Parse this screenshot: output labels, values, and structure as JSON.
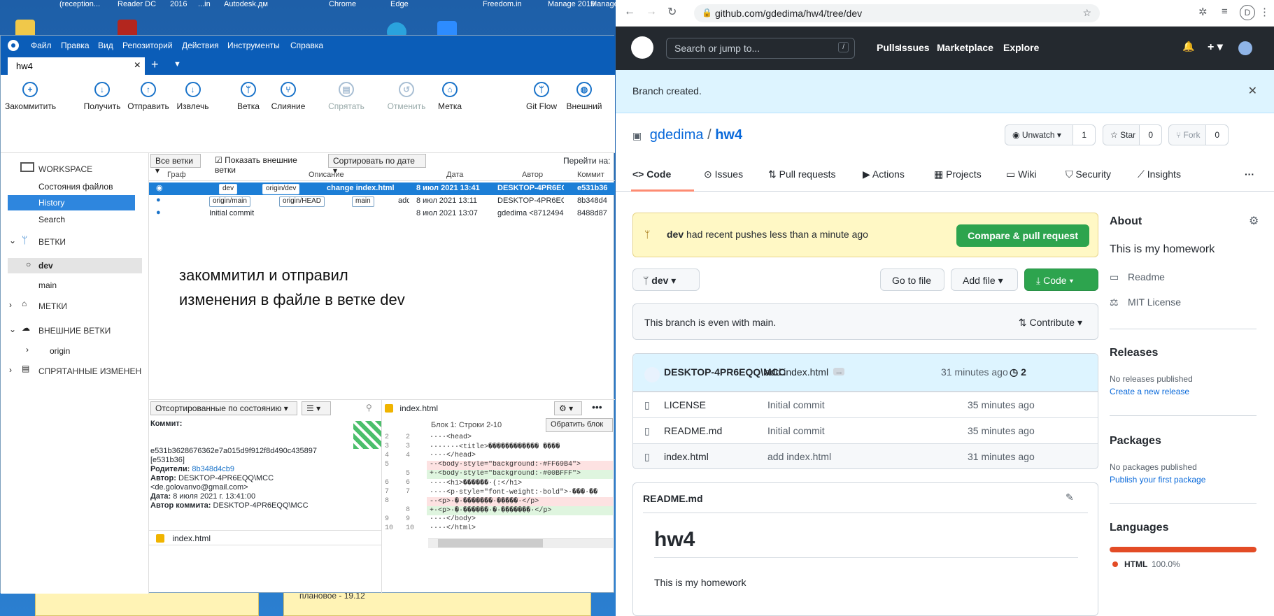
{
  "desktop": {
    "top_labels": [
      "(reception...",
      "Reader DC",
      "2016",
      "...in",
      "Autodesk.дм",
      "Chrome",
      "Edge",
      "Freedom.in",
      "Manage 2019",
      "Manage"
    ],
    "note_mid_text": "плановое - 19.12"
  },
  "sourcetree": {
    "menu": [
      "Файл",
      "Правка",
      "Вид",
      "Репозиторий",
      "Действия",
      "Инструменты",
      "Справка"
    ],
    "tab_label": "hw4",
    "toolbar": [
      {
        "label": "Закоммитить",
        "icon": "commit-icon",
        "glyph": "+",
        "disabled": false
      },
      {
        "label": "Получить",
        "icon": "pull-icon",
        "glyph": "↓",
        "disabled": false
      },
      {
        "label": "Отправить",
        "icon": "push-icon",
        "glyph": "↑",
        "disabled": false
      },
      {
        "label": "Извлечь",
        "icon": "fetch-icon",
        "glyph": "↓",
        "disabled": false
      },
      {
        "label": "Ветка",
        "icon": "branch-icon",
        "glyph": "ᛘ",
        "disabled": false
      },
      {
        "label": "Слияние",
        "icon": "merge-icon",
        "glyph": "⑂",
        "disabled": false
      },
      {
        "label": "Спрятать",
        "icon": "stash-icon",
        "glyph": "▤",
        "disabled": true
      },
      {
        "label": "Отменить",
        "icon": "discard-icon",
        "glyph": "↺",
        "disabled": true
      },
      {
        "label": "Метка",
        "icon": "tag-icon",
        "glyph": "⌂",
        "disabled": false
      },
      {
        "label": "Git Flow",
        "icon": "gitflow-icon",
        "glyph": "ᛘ",
        "disabled": false
      },
      {
        "label": "Внешний",
        "icon": "terminal-icon",
        "glyph": "◍",
        "disabled": false
      }
    ],
    "sidebar": {
      "workspace": "WORKSPACE",
      "file_status": "Состояния файлов",
      "history": "History",
      "search": "Search",
      "branches": "ВЕТКИ",
      "branch_dev": "dev",
      "branch_main": "main",
      "tags": "МЕТКИ",
      "remotes": "ВНЕШНИЕ ВЕТКИ",
      "remote_origin": "origin",
      "stashes": "СПРЯТАННЫЕ ИЗМЕНЕН"
    },
    "filters": {
      "all_branches": "Все ветки",
      "show_remote": "Показать внешние ветки",
      "sort": "Сортировать по дате",
      "goto": "Перейти на:"
    },
    "columns": [
      "Граф",
      "Описание",
      "Дата",
      "Автор",
      "Коммит"
    ],
    "commits": [
      {
        "tags": [
          "dev",
          "origin/dev"
        ],
        "message": "change index.html",
        "date": "8 июл 2021 13:41",
        "author": "DESKTOP-4PR6EC",
        "hash": "e531b36"
      },
      {
        "tags": [
          "origin/main",
          "origin/HEAD",
          "main"
        ],
        "message": "adc",
        "date": "8 июл 2021 13:11",
        "author": "DESKTOP-4PR6EQ",
        "hash": "8b348d4"
      },
      {
        "tags": [],
        "message": "Initial commit",
        "date": "8 июл 2021 13:07",
        "author": "gdedima <8712494",
        "hash": "8488d87"
      }
    ],
    "annotation": [
      "закоммитил и отправил",
      "изменения в файле в ветке dev"
    ],
    "details": {
      "sort_label": "Отсортированные по состоянию",
      "commit_label": "Коммит:",
      "hash": "e531b3628676362e7a015d9f912f8d490c435897",
      "short": "[e531b36]",
      "parents_label": "Родители:",
      "parents": "8b348d4cb9",
      "author_label": "Автор:",
      "author": "DESKTOP-4PR6EQQ\\MCC",
      "email": "<de.golovanvo@gmail.com>",
      "date_label": "Дата:",
      "date": "8 июля 2021 г. 13:41:00",
      "committer_label": "Автор коммита:",
      "committer": "DESKTOP-4PR6EQQ\\MCC",
      "file": "index.html"
    },
    "diff": {
      "file": "index.html",
      "hunk": "Блок 1: Строки 2-10",
      "revert": "Обратить блок",
      "lines": [
        {
          "a": "2",
          "b": "2",
          "t": "ctx",
          "text": "····<head>"
        },
        {
          "a": "3",
          "b": "3",
          "t": "ctx",
          "text": "·······<title>������������ ����"
        },
        {
          "a": "4",
          "b": "4",
          "t": "ctx",
          "text": "····</head>"
        },
        {
          "a": "5",
          "b": "",
          "t": "del",
          "text": "-·<body·style=\"background:·#FF69B4\">"
        },
        {
          "a": "",
          "b": "5",
          "t": "add",
          "text": "+·<body·style=\"background:·#00BFFF\">"
        },
        {
          "a": "6",
          "b": "6",
          "t": "ctx",
          "text": "····<h1>������·(:</h1>"
        },
        {
          "a": "7",
          "b": "7",
          "t": "ctx",
          "text": "····<p·style=\"font-weight:·bold\">·���·��"
        },
        {
          "a": "8",
          "b": "",
          "t": "del",
          "text": "-·<p>·�·�������·�����·</p>"
        },
        {
          "a": "",
          "b": "8",
          "t": "add",
          "text": "+·<p>·�·������·�·�������·</p>"
        },
        {
          "a": "9",
          "b": "9",
          "t": "ctx",
          "text": "····</body>"
        },
        {
          "a": "10",
          "b": "10",
          "t": "ctx",
          "text": "····</html>"
        }
      ]
    }
  },
  "browser": {
    "url": "github.com/gdedima/hw4/tree/dev",
    "profile_initial": "D"
  },
  "github": {
    "search_placeholder": "Search or jump to...",
    "search_key": "/",
    "nav": [
      "Pulls",
      "Issues",
      "Marketplace",
      "Explore"
    ],
    "flash": "Branch created.",
    "owner": "gdedima",
    "sep": "/",
    "repo": "hw4",
    "unwatch": "Unwatch ▾",
    "unwatch_count": "1",
    "star": "Star",
    "star_count": "0",
    "fork": "Fork",
    "fork_count": "0",
    "tabs": [
      "Code",
      "Issues",
      "Pull requests",
      "Actions",
      "Projects",
      "Wiki",
      "Security",
      "Insights"
    ],
    "more": "···",
    "push_branch": "dev",
    "push_text": "had recent pushes less than a minute ago",
    "compare": "Compare & pull request",
    "branch": "dev",
    "go_to_file": "Go to file",
    "add_file": "Add file ▾",
    "code_btn": "Code ▾",
    "even_text": "This branch is even with main.",
    "contribute": "Contribute ▾",
    "last_commit_author": "DESKTOP-4PR6EQQ\\MCC",
    "last_commit_msg": "add index.html",
    "last_commit_more": "...",
    "last_commit_time": "31 minutes ago",
    "commit_count": "2",
    "files": [
      {
        "name": "LICENSE",
        "msg": "Initial commit",
        "time": "35 minutes ago"
      },
      {
        "name": "README.md",
        "msg": "Initial commit",
        "time": "35 minutes ago"
      },
      {
        "name": "index.html",
        "msg": "add index.html",
        "time": "31 minutes ago"
      }
    ],
    "readme_label": "README.md",
    "readme_title": "hw4",
    "readme_body": "This is my homework",
    "about": {
      "title": "About",
      "desc": "This is my homework",
      "readme": "Readme",
      "license": "MIT License",
      "releases": "Releases",
      "no_releases": "No releases published",
      "create_release": "Create a new release",
      "packages": "Packages",
      "no_packages": "No packages published",
      "publish_package": "Publish your first package",
      "languages": "Languages",
      "lang_name": "HTML",
      "lang_pct": "100.0%",
      "lang_color": "#e34c26",
      "lang_share": 1.0
    }
  }
}
